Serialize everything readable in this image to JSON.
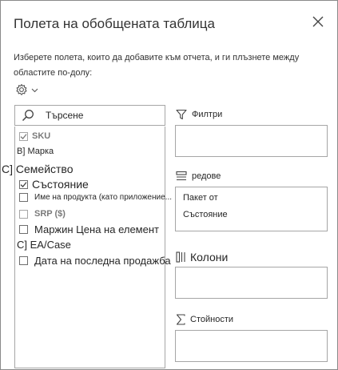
{
  "pane": {
    "title": "Полета на обобщената таблица",
    "instruction": "Изберете полета, които да добавите към отчета, и ги плъзнете между областите по-долу:"
  },
  "search": {
    "placeholder": "Търсене"
  },
  "fields": [
    {
      "label": "SKU",
      "checked": true,
      "style": "gray-bold"
    },
    {
      "label": "B] Марка",
      "checkbox": false
    },
    {
      "label": "C] Семейство",
      "checkbox": false
    },
    {
      "label": "Състояние",
      "checked": true
    },
    {
      "label": "Име на продукта (като приложение...",
      "checked": false
    },
    {
      "label": "SRP ($)",
      "checked": false,
      "style": "gray-bold"
    },
    {
      "label": "Маржин Цена на елемент",
      "checked": false
    },
    {
      "label": "C] EA/Case",
      "checkbox": false
    },
    {
      "label": "Дата на последна продажба",
      "checked": false
    }
  ],
  "areas": {
    "filters": {
      "label": "Филтри",
      "icon": "filter-icon",
      "items": []
    },
    "rows": {
      "label": "редове",
      "icon": "rows-icon",
      "items": [
        "Пакет от",
        "Състояние"
      ]
    },
    "columns": {
      "label": "Колони",
      "icon": "columns-icon",
      "items": []
    },
    "values": {
      "label": "Стойности",
      "icon": "sigma-icon",
      "items": []
    }
  }
}
